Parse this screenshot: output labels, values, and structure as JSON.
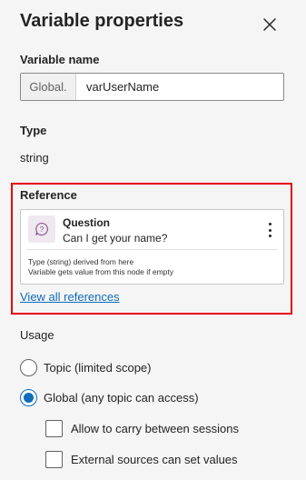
{
  "header": {
    "title": "Variable properties",
    "close_icon": "close-icon"
  },
  "variable_name": {
    "label": "Variable name",
    "prefix": "Global.",
    "value": "varUserName"
  },
  "type": {
    "label": "Type",
    "value": "string"
  },
  "reference": {
    "label": "Reference",
    "highlight_color": "#e3000b",
    "card": {
      "icon": "question-node-icon",
      "node_type": "Question",
      "node_text": "Can I get your name?",
      "menu_icon": "more-vertical-icon",
      "note_line1": "Type (string) derived from here",
      "note_line2": "Variable gets value from this node if empty"
    },
    "view_all_link": "View all references"
  },
  "usage": {
    "label": "Usage",
    "options": [
      {
        "label": "Topic (limited scope)",
        "selected": false
      },
      {
        "label": "Global (any topic can access)",
        "selected": true
      }
    ],
    "checkboxes": [
      {
        "label": "Allow to carry between sessions",
        "checked": false
      },
      {
        "label": "External sources can set values",
        "checked": false
      }
    ],
    "accent_color": "#0f6cbd"
  }
}
